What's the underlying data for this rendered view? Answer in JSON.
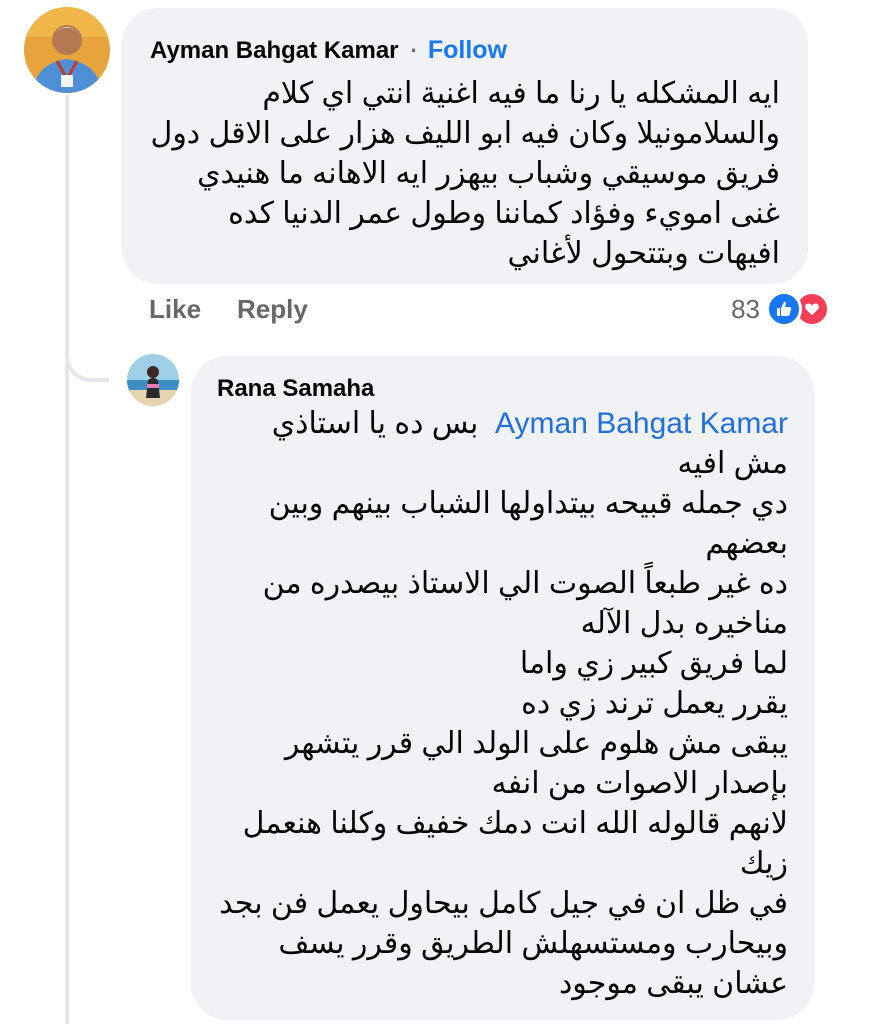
{
  "colors": {
    "bubble": "#f0f2f5",
    "link": "#1877f2",
    "mention": "#216fdb",
    "muted": "#65676b",
    "like": "#1877f2",
    "love": "#f33e58"
  },
  "comment": {
    "author": "Ayman Bahgat Kamar",
    "separator": "·",
    "follow_label": "Follow",
    "body": "ايه المشكله يا رنا ما فيه اغنية انتي اي كلام والسلامونيلا وكان فيه ابو الليف هزار على الاقل دول فريق موسيقي وشباب بيهزر ايه الاهانه ما هنيدي غنى امويء وفؤاد كماننا وطول عمر الدنيا كده افيهات وبتتحول لأغاني",
    "actions": {
      "like": "Like",
      "reply": "Reply"
    },
    "reactions": {
      "count": "83",
      "icons": [
        "like-icon",
        "love-icon"
      ]
    }
  },
  "reply": {
    "author": "Rana Samaha",
    "mention": "Ayman Bahgat Kamar",
    "lines": [
      "بس ده يا استاذي مش افيه",
      "دي جمله قبيحه بيتداولها الشباب بينهم وبين بعضهم",
      "ده غير طبعاً الصوت الي الاستاذ بيصدره من مناخيره بدل الآله",
      "لما فريق كبير زي واما",
      "يقرر يعمل ترند زي ده",
      "يبقى مش هلوم على الولد الي قرر يتشهر بإصدار الاصوات من انفه",
      "لانهم قالوله الله انت دمك خفيف وكلنا هنعمل زيك",
      "في ظل ان في جيل كامل بيحاول يعمل فن بجد وبيحارب ومستسهلش الطريق وقرر يسف عشان يبقى موجود"
    ]
  }
}
